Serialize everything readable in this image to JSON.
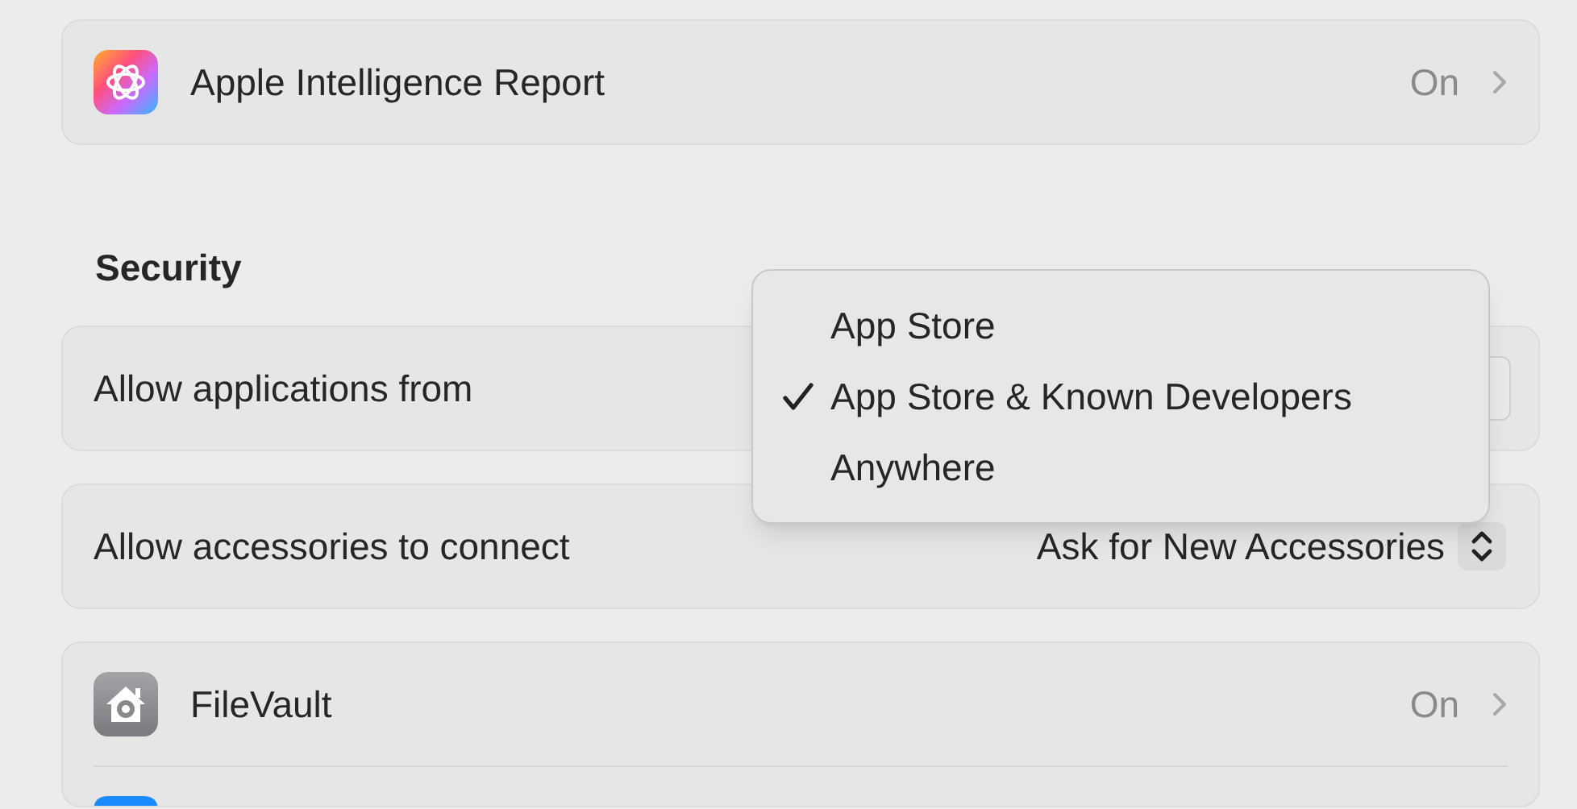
{
  "cards": [
    {
      "rows": [
        {
          "kind": "link",
          "label": "Apple Intelligence Report",
          "value": "On"
        }
      ]
    },
    {
      "heading": "Security",
      "rows": [
        {
          "kind": "popup",
          "label": "Allow applications from"
        }
      ]
    },
    {
      "rows": [
        {
          "kind": "popup",
          "label": "Allow accessories to connect",
          "value": "Ask for New Accessories"
        }
      ]
    },
    {
      "rows": [
        {
          "kind": "link",
          "label": "FileVault",
          "value": "On"
        },
        {
          "kind": "partial"
        }
      ]
    }
  ],
  "menu": {
    "items": [
      {
        "label": "App Store",
        "selected": false
      },
      {
        "label": "App Store & Known Developers",
        "selected": true
      },
      {
        "label": "Anywhere",
        "selected": false
      }
    ]
  }
}
